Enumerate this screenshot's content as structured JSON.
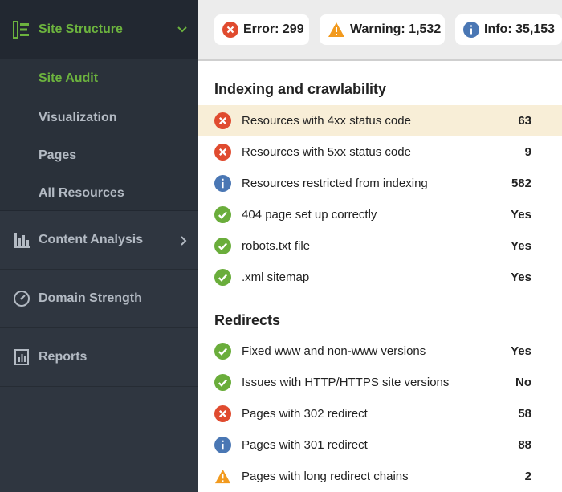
{
  "sidebar": {
    "site_structure": {
      "label": "Site Structure",
      "icon": "site-structure-icon"
    },
    "sub_items": [
      {
        "label": "Site Audit",
        "active": true
      },
      {
        "label": "Visualization",
        "active": false
      },
      {
        "label": "Pages",
        "active": false
      },
      {
        "label": "All Resources",
        "active": false
      }
    ],
    "content_analysis": {
      "label": "Content Analysis",
      "icon": "content-analysis-icon"
    },
    "domain_strength": {
      "label": "Domain Strength",
      "icon": "gauge-icon"
    },
    "reports": {
      "label": "Reports",
      "icon": "report-icon"
    }
  },
  "summary": {
    "error": {
      "label": "Error: 299",
      "icon": "error-icon",
      "color": "#e04b2f"
    },
    "warning": {
      "label": "Warning: 1,532",
      "icon": "warning-icon",
      "color": "#f29a1e"
    },
    "info": {
      "label": "Info: 35,153",
      "icon": "info-icon",
      "color": "#4a77b4"
    }
  },
  "sections": [
    {
      "title": "Indexing and crawlability",
      "rows": [
        {
          "status": "error",
          "text": "Resources with 4xx status code",
          "value": "63",
          "highlight": true
        },
        {
          "status": "error",
          "text": "Resources with 5xx status code",
          "value": "9"
        },
        {
          "status": "info",
          "text": "Resources restricted from indexing",
          "value": "582"
        },
        {
          "status": "ok",
          "text": "404 page set up correctly",
          "value": "Yes"
        },
        {
          "status": "ok",
          "text": "robots.txt file",
          "value": "Yes"
        },
        {
          "status": "ok",
          "text": ".xml sitemap",
          "value": "Yes"
        }
      ]
    },
    {
      "title": "Redirects",
      "rows": [
        {
          "status": "ok",
          "text": "Fixed www and non-www versions",
          "value": "Yes"
        },
        {
          "status": "ok",
          "text": "Issues with HTTP/HTTPS site versions",
          "value": "No"
        },
        {
          "status": "error",
          "text": "Pages with 302 redirect",
          "value": "58"
        },
        {
          "status": "info",
          "text": "Pages with 301 redirect",
          "value": "88"
        },
        {
          "status": "warning",
          "text": "Pages with long redirect chains",
          "value": "2"
        }
      ]
    }
  ],
  "colors": {
    "accent": "#6cb33e",
    "ok": "#6aad3b",
    "error": "#e04b2f",
    "info": "#4a77b4",
    "warning": "#f29a1e",
    "highlight": "#f8eed7"
  }
}
